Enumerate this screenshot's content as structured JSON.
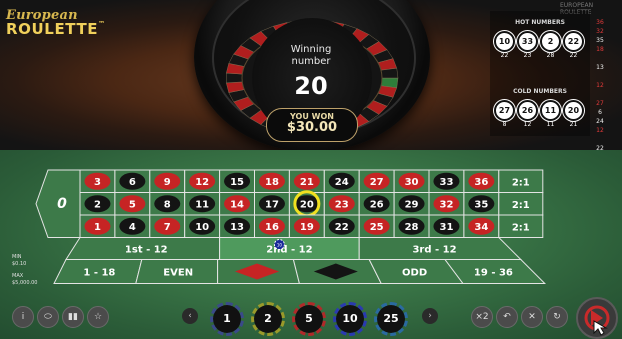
{
  "logo": {
    "top": "European",
    "bottom": "ROULETTE",
    "tm": "™"
  },
  "brand_caption": "EUROPEAN ROULETTE",
  "win": {
    "label_line1": "Winning",
    "label_line2": "number",
    "number": "20",
    "you_won": "YOU WON",
    "amount": "$30.00"
  },
  "hot": {
    "title": "HOT NUMBERS",
    "numbers": [
      "10",
      "33",
      "2",
      "22"
    ],
    "counts": [
      "22",
      "23",
      "28",
      "22"
    ]
  },
  "cold": {
    "title": "COLD NUMBERS",
    "numbers": [
      "27",
      "26",
      "11",
      "20"
    ],
    "counts": [
      "8",
      "12",
      "11",
      "21"
    ]
  },
  "history": [
    {
      "n": "36",
      "c": "red"
    },
    {
      "n": "32",
      "c": "red"
    },
    {
      "n": "35",
      "c": "white"
    },
    {
      "n": "18",
      "c": "red"
    },
    {
      "n": "",
      "c": "white"
    },
    {
      "n": "13",
      "c": "white"
    },
    {
      "n": "",
      "c": "white"
    },
    {
      "n": "12",
      "c": "red"
    },
    {
      "n": "",
      "c": "white"
    },
    {
      "n": "27",
      "c": "red"
    },
    {
      "n": "6",
      "c": "white"
    },
    {
      "n": "24",
      "c": "white"
    },
    {
      "n": "12",
      "c": "red"
    },
    {
      "n": "",
      "c": "white"
    },
    {
      "n": "22",
      "c": "white"
    }
  ],
  "table": {
    "zero": "0",
    "rows": [
      [
        "3",
        "6",
        "9",
        "12",
        "15",
        "18",
        "21",
        "24",
        "27",
        "30",
        "33",
        "36"
      ],
      [
        "2",
        "5",
        "8",
        "11",
        "14",
        "17",
        "20",
        "23",
        "26",
        "29",
        "32",
        "35"
      ],
      [
        "1",
        "4",
        "7",
        "10",
        "13",
        "16",
        "19",
        "22",
        "25",
        "28",
        "31",
        "34"
      ]
    ],
    "red_numbers": [
      "1",
      "3",
      "5",
      "7",
      "9",
      "12",
      "14",
      "16",
      "18",
      "19",
      "21",
      "23",
      "25",
      "27",
      "30",
      "32",
      "34",
      "36"
    ],
    "column_bets": [
      "2:1",
      "2:1",
      "2:1"
    ],
    "dozens": [
      "1st - 12",
      "2nd - 12",
      "3rd - 12"
    ],
    "outside": [
      "1 - 18",
      "EVEN",
      "",
      "",
      "ODD",
      "19 - 36"
    ],
    "highlighted": "20",
    "chip_on_dozen": "10"
  },
  "limits": {
    "min_label": "MIN",
    "min_value": "$0.10",
    "max_label": "MAX",
    "max_value": "$5,000.00"
  },
  "chips": [
    "1",
    "2",
    "5",
    "10",
    "25"
  ],
  "chip_colors": [
    "#3a4a8a",
    "#9a9a2a",
    "#b02a2a",
    "#2a3ab0",
    "#2a6aa0"
  ],
  "controls": {
    "double": "×2",
    "info": "i"
  }
}
